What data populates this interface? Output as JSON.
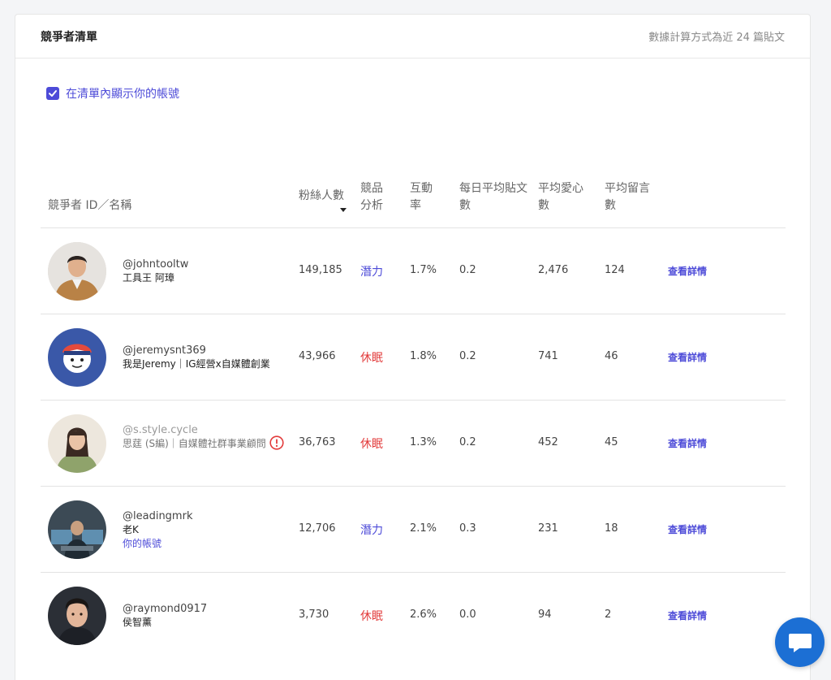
{
  "header": {
    "title": "競爭者清單",
    "note": "數據計算方式為近 24 篇貼文"
  },
  "show_own_account": {
    "label": "在清單內顯示你的帳號",
    "checked": true
  },
  "columns": {
    "name": "競爭者 ID／名稱",
    "followers": "粉絲人數",
    "analysis": "競品分析",
    "engagement": "互動率",
    "daily_posts": "每日平均貼文數",
    "avg_likes": "平均愛心數",
    "avg_comments": "平均留言數"
  },
  "rows": [
    {
      "handle": "@johntooltw",
      "name": "工具王 阿璋",
      "followers": "149,185",
      "analysis": "潛力",
      "analysis_status": "potential",
      "engagement": "1.7%",
      "daily_posts": "0.2",
      "avg_likes": "2,476",
      "avg_comments": "124",
      "detail": "查看詳情"
    },
    {
      "handle": "@jeremysnt369",
      "name": "我是Jeremy｜IG經營x自媒體創業",
      "followers": "43,966",
      "analysis": "休眠",
      "analysis_status": "dormant",
      "engagement": "1.8%",
      "daily_posts": "0.2",
      "avg_likes": "741",
      "avg_comments": "46",
      "detail": "查看詳情"
    },
    {
      "handle": "@s.style.cycle",
      "name": "思莛 (S編)｜自媒體社群事業顧問",
      "followers": "36,763",
      "analysis": "休眠",
      "analysis_status": "dormant",
      "engagement": "1.3%",
      "daily_posts": "0.2",
      "avg_likes": "452",
      "avg_comments": "45",
      "detail": "查看詳情",
      "warning": true
    },
    {
      "handle": "@leadingmrk",
      "name": "老K",
      "own_label": "你的帳號",
      "followers": "12,706",
      "analysis": "潛力",
      "analysis_status": "potential",
      "engagement": "2.1%",
      "daily_posts": "0.3",
      "avg_likes": "231",
      "avg_comments": "18",
      "detail": "查看詳情"
    },
    {
      "handle": "@raymond0917",
      "name": "侯智薰",
      "followers": "3,730",
      "analysis": "休眠",
      "analysis_status": "dormant",
      "engagement": "2.6%",
      "daily_posts": "0.0",
      "avg_likes": "94",
      "avg_comments": "2",
      "detail": "查看詳情"
    }
  ],
  "colors": {
    "accent": "#4d4bd8",
    "dormant": "#e23b3b",
    "chat": "#1c6fd4"
  }
}
